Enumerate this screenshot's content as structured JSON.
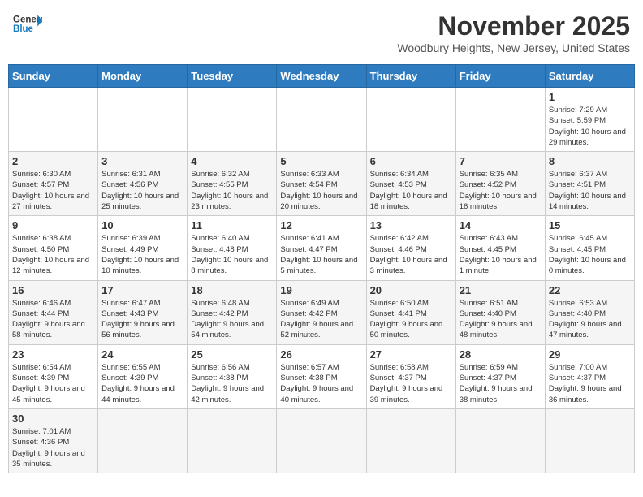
{
  "header": {
    "logo_general": "General",
    "logo_blue": "Blue",
    "month_title": "November 2025",
    "location": "Woodbury Heights, New Jersey, United States"
  },
  "days_of_week": [
    "Sunday",
    "Monday",
    "Tuesday",
    "Wednesday",
    "Thursday",
    "Friday",
    "Saturday"
  ],
  "weeks": [
    [
      {
        "day": "",
        "info": ""
      },
      {
        "day": "",
        "info": ""
      },
      {
        "day": "",
        "info": ""
      },
      {
        "day": "",
        "info": ""
      },
      {
        "day": "",
        "info": ""
      },
      {
        "day": "",
        "info": ""
      },
      {
        "day": "1",
        "info": "Sunrise: 7:29 AM\nSunset: 5:59 PM\nDaylight: 10 hours and 29 minutes."
      }
    ],
    [
      {
        "day": "2",
        "info": "Sunrise: 6:30 AM\nSunset: 4:57 PM\nDaylight: 10 hours and 27 minutes."
      },
      {
        "day": "3",
        "info": "Sunrise: 6:31 AM\nSunset: 4:56 PM\nDaylight: 10 hours and 25 minutes."
      },
      {
        "day": "4",
        "info": "Sunrise: 6:32 AM\nSunset: 4:55 PM\nDaylight: 10 hours and 23 minutes."
      },
      {
        "day": "5",
        "info": "Sunrise: 6:33 AM\nSunset: 4:54 PM\nDaylight: 10 hours and 20 minutes."
      },
      {
        "day": "6",
        "info": "Sunrise: 6:34 AM\nSunset: 4:53 PM\nDaylight: 10 hours and 18 minutes."
      },
      {
        "day": "7",
        "info": "Sunrise: 6:35 AM\nSunset: 4:52 PM\nDaylight: 10 hours and 16 minutes."
      },
      {
        "day": "8",
        "info": "Sunrise: 6:37 AM\nSunset: 4:51 PM\nDaylight: 10 hours and 14 minutes."
      }
    ],
    [
      {
        "day": "9",
        "info": "Sunrise: 6:38 AM\nSunset: 4:50 PM\nDaylight: 10 hours and 12 minutes."
      },
      {
        "day": "10",
        "info": "Sunrise: 6:39 AM\nSunset: 4:49 PM\nDaylight: 10 hours and 10 minutes."
      },
      {
        "day": "11",
        "info": "Sunrise: 6:40 AM\nSunset: 4:48 PM\nDaylight: 10 hours and 8 minutes."
      },
      {
        "day": "12",
        "info": "Sunrise: 6:41 AM\nSunset: 4:47 PM\nDaylight: 10 hours and 5 minutes."
      },
      {
        "day": "13",
        "info": "Sunrise: 6:42 AM\nSunset: 4:46 PM\nDaylight: 10 hours and 3 minutes."
      },
      {
        "day": "14",
        "info": "Sunrise: 6:43 AM\nSunset: 4:45 PM\nDaylight: 10 hours and 1 minute."
      },
      {
        "day": "15",
        "info": "Sunrise: 6:45 AM\nSunset: 4:45 PM\nDaylight: 10 hours and 0 minutes."
      }
    ],
    [
      {
        "day": "16",
        "info": "Sunrise: 6:46 AM\nSunset: 4:44 PM\nDaylight: 9 hours and 58 minutes."
      },
      {
        "day": "17",
        "info": "Sunrise: 6:47 AM\nSunset: 4:43 PM\nDaylight: 9 hours and 56 minutes."
      },
      {
        "day": "18",
        "info": "Sunrise: 6:48 AM\nSunset: 4:42 PM\nDaylight: 9 hours and 54 minutes."
      },
      {
        "day": "19",
        "info": "Sunrise: 6:49 AM\nSunset: 4:42 PM\nDaylight: 9 hours and 52 minutes."
      },
      {
        "day": "20",
        "info": "Sunrise: 6:50 AM\nSunset: 4:41 PM\nDaylight: 9 hours and 50 minutes."
      },
      {
        "day": "21",
        "info": "Sunrise: 6:51 AM\nSunset: 4:40 PM\nDaylight: 9 hours and 48 minutes."
      },
      {
        "day": "22",
        "info": "Sunrise: 6:53 AM\nSunset: 4:40 PM\nDaylight: 9 hours and 47 minutes."
      }
    ],
    [
      {
        "day": "23",
        "info": "Sunrise: 6:54 AM\nSunset: 4:39 PM\nDaylight: 9 hours and 45 minutes."
      },
      {
        "day": "24",
        "info": "Sunrise: 6:55 AM\nSunset: 4:39 PM\nDaylight: 9 hours and 44 minutes."
      },
      {
        "day": "25",
        "info": "Sunrise: 6:56 AM\nSunset: 4:38 PM\nDaylight: 9 hours and 42 minutes."
      },
      {
        "day": "26",
        "info": "Sunrise: 6:57 AM\nSunset: 4:38 PM\nDaylight: 9 hours and 40 minutes."
      },
      {
        "day": "27",
        "info": "Sunrise: 6:58 AM\nSunset: 4:37 PM\nDaylight: 9 hours and 39 minutes."
      },
      {
        "day": "28",
        "info": "Sunrise: 6:59 AM\nSunset: 4:37 PM\nDaylight: 9 hours and 38 minutes."
      },
      {
        "day": "29",
        "info": "Sunrise: 7:00 AM\nSunset: 4:37 PM\nDaylight: 9 hours and 36 minutes."
      }
    ],
    [
      {
        "day": "30",
        "info": "Sunrise: 7:01 AM\nSunset: 4:36 PM\nDaylight: 9 hours and 35 minutes."
      },
      {
        "day": "",
        "info": ""
      },
      {
        "day": "",
        "info": ""
      },
      {
        "day": "",
        "info": ""
      },
      {
        "day": "",
        "info": ""
      },
      {
        "day": "",
        "info": ""
      },
      {
        "day": "",
        "info": ""
      }
    ]
  ]
}
